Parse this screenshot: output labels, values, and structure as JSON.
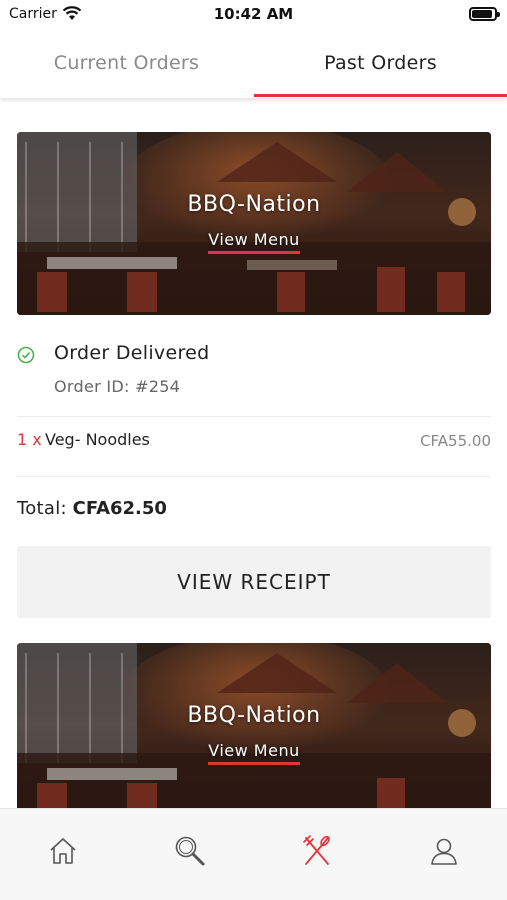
{
  "status_bar": {
    "carrier": "Carrier",
    "time": "10:42 AM",
    "battery_level": 0.9
  },
  "tabs": [
    {
      "label": "Current Orders",
      "active": false
    },
    {
      "label": "Past Orders",
      "active": true
    }
  ],
  "orders": [
    {
      "restaurant": "BBQ-Nation",
      "view_menu_label": "View Menu",
      "status": "Order Delivered",
      "order_id": "Order ID: #254",
      "items": [
        {
          "qty": "1 x",
          "name": "Veg- Noodles",
          "price": "CFA55.00"
        }
      ],
      "total_label": "Total:",
      "total_value": "CFA62.50",
      "receipt_button": "VIEW RECEIPT"
    },
    {
      "restaurant": "BBQ-Nation",
      "view_menu_label": "View Menu"
    }
  ],
  "bottom_nav": [
    {
      "icon": "home-icon"
    },
    {
      "icon": "search-icon"
    },
    {
      "icon": "fork-knife-icon",
      "active": true
    },
    {
      "icon": "user-icon"
    }
  ],
  "colors": {
    "accent": "#e0353a",
    "success": "#4caf50",
    "inactive_icon": "#555555"
  }
}
